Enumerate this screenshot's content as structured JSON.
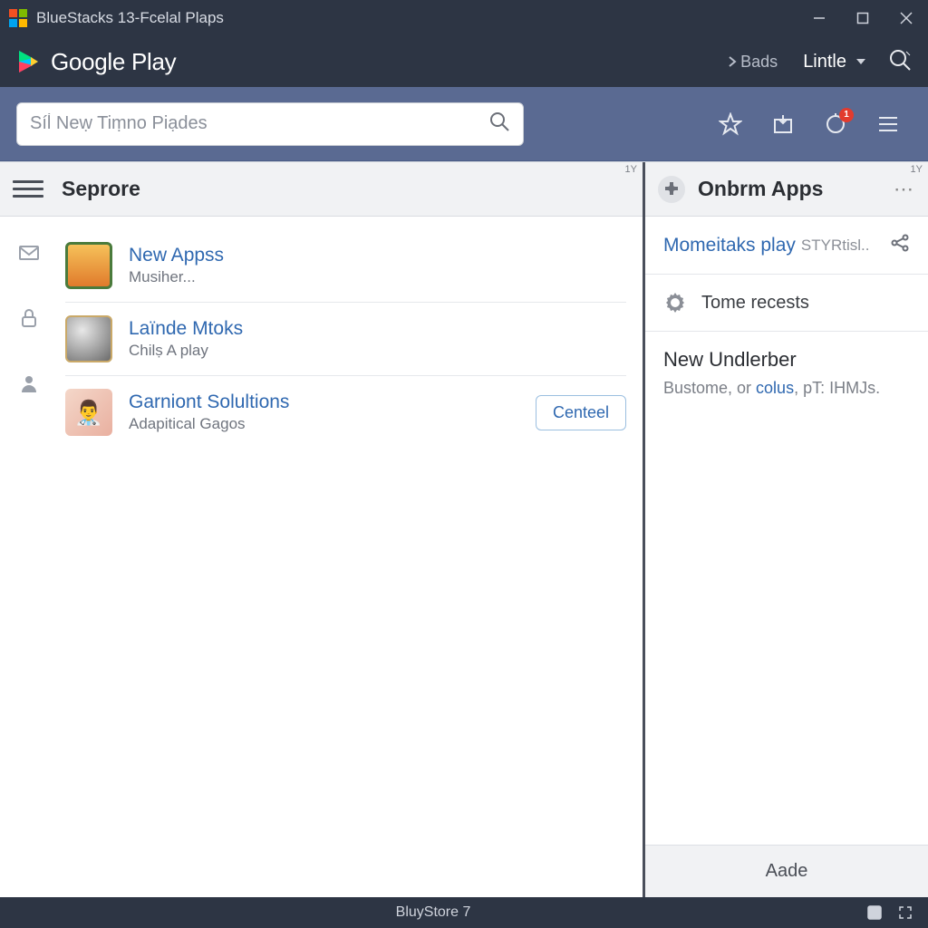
{
  "window": {
    "title": "BlueStacks 13-Fcelal Plaps"
  },
  "play_header": {
    "brand": "Google Play",
    "bads_label": "Bads",
    "menu_label": "Lintle"
  },
  "search": {
    "placeholder": "Síl̇ Neẉ Tiṃno Piạdes"
  },
  "toolbar_icons": {
    "notification_badge": "1"
  },
  "left_panel": {
    "corner_tag": "1Y",
    "header": "Seprore",
    "items": [
      {
        "title": "New Appss",
        "subtitle": "Musiher..."
      },
      {
        "title": "Laïnde Mtoks",
        "subtitle": "Chilṣ A play"
      },
      {
        "title": "Garniont Solultions",
        "subtitle": "Adapitical Gagos",
        "action": "Centeel"
      }
    ]
  },
  "right_panel": {
    "corner_tag": "1Y",
    "header": "Onbrm Apps",
    "momeitaks": {
      "title": "Momeitaks play",
      "sub": "STYRtisl.."
    },
    "tome": "Tome recests",
    "undler": {
      "title": "New Undlerber",
      "body_pre": "Bustome, or ",
      "body_link": "colus",
      "body_post": ", pT: IHMJs."
    },
    "footer": "Aade"
  },
  "statusbar": {
    "center": "BluyStore 7"
  }
}
